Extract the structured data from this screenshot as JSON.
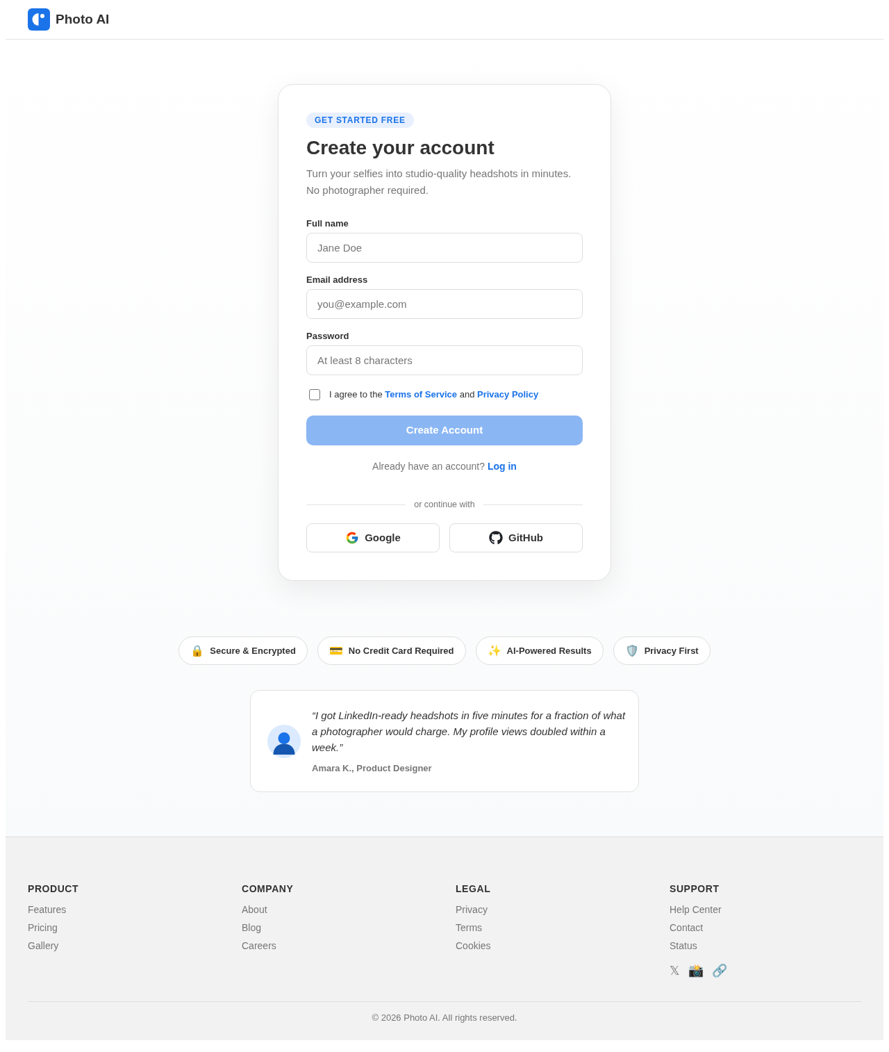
{
  "header": {
    "brand": "Photo AI"
  },
  "signup": {
    "badge": "GET STARTED FREE",
    "title": "Create your account",
    "subtitle": "Turn your selfies into studio-quality headshots in minutes. No photographer required.",
    "fields": [
      {
        "label": "Full name",
        "placeholder": "Jane Doe"
      },
      {
        "label": "Email address",
        "placeholder": "you@example.com"
      },
      {
        "label": "Password",
        "placeholder": "At least 8 characters"
      }
    ],
    "agreement": {
      "checked": false,
      "text": "I agree to the",
      "terms_link": "Terms of Service",
      "joiner": "and",
      "privacy_link": "Privacy Policy"
    },
    "submit": {
      "label": "Create Account",
      "disabled": true
    },
    "login_prompt": {
      "text": "Already have an account?",
      "link": "Log in"
    },
    "divider": "or continue with",
    "providers": [
      {
        "label": "Google"
      },
      {
        "label": "GitHub"
      }
    ]
  },
  "features": [
    {
      "icon": "🔒",
      "label": "Secure & Encrypted"
    },
    {
      "icon": "💳",
      "label": "No Credit Card Required"
    },
    {
      "icon": "✨",
      "label": "AI-Powered Results"
    },
    {
      "icon": "🛡️",
      "label": "Privacy First"
    }
  ],
  "testimonial": {
    "quote": "“I got LinkedIn-ready headshots in five minutes for a fraction of what a photographer would charge. My profile views doubled within a week.”",
    "author": "Amara K., Product Designer"
  },
  "footer": {
    "columns": [
      {
        "heading": "PRODUCT",
        "links": [
          "Features",
          "Pricing",
          "Gallery"
        ]
      },
      {
        "heading": "COMPANY",
        "links": [
          "About",
          "Blog",
          "Careers"
        ]
      },
      {
        "heading": "LEGAL",
        "links": [
          "Privacy",
          "Terms",
          "Cookies"
        ]
      },
      {
        "heading": "SUPPORT",
        "links": [
          "Help Center",
          "Contact",
          "Status"
        ]
      }
    ],
    "social": [
      {
        "icon": "𝕏"
      },
      {
        "icon": "📸"
      },
      {
        "icon": "🔗"
      }
    ],
    "copyright": "© 2026 Photo AI. All rights reserved."
  }
}
